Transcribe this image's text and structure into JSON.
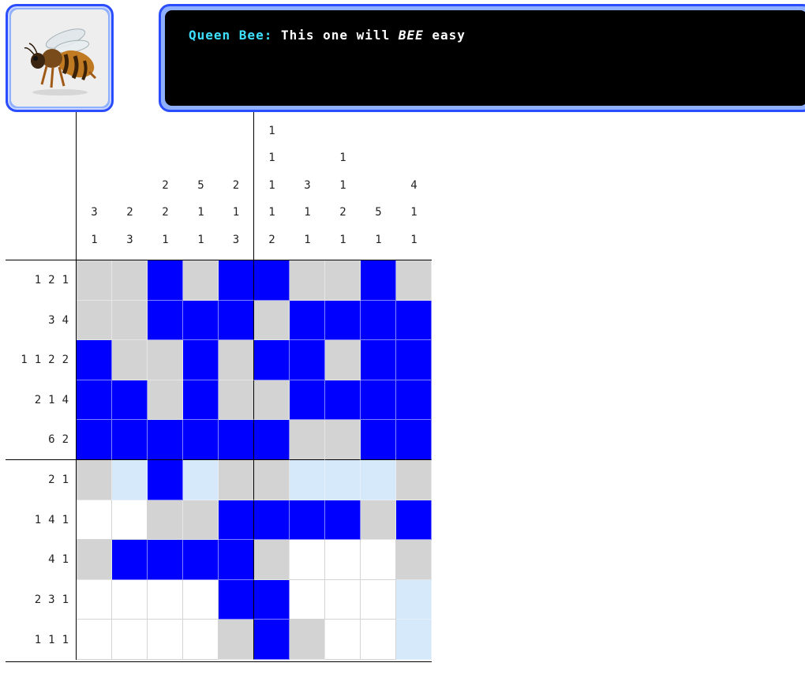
{
  "portrait": {
    "subject": "honeybee"
  },
  "dialog": {
    "speaker": "Queen Bee:",
    "text_before": "This one will ",
    "text_emph": "BEE",
    "text_after": " easy"
  },
  "colors": {
    "filled": "#0000ff",
    "crossed": "#d3d3d3",
    "hint": "#d6e9fb",
    "empty": "#ffffff",
    "frame": "#2a4dff"
  },
  "puzzle": {
    "col_clues": [
      [
        "3",
        "1"
      ],
      [
        "2",
        "3"
      ],
      [
        "2",
        "2",
        "1"
      ],
      [
        "5",
        "1",
        "1"
      ],
      [
        "2",
        "1",
        "3"
      ],
      [
        "1",
        "1",
        "1",
        "1",
        "2"
      ],
      [
        "3",
        "1",
        "1"
      ],
      [
        "1",
        "1",
        "2",
        "1"
      ],
      [
        "5",
        "1"
      ],
      [
        "4",
        "1",
        "1"
      ]
    ],
    "row_clues": [
      [
        "1",
        "2",
        "1"
      ],
      [
        "3",
        "4"
      ],
      [
        "1",
        "1",
        "2",
        "2"
      ],
      [
        "2",
        "1",
        "4"
      ],
      [
        "6",
        "2"
      ],
      [
        "2",
        "1"
      ],
      [
        "1",
        "4",
        "1"
      ],
      [
        "4",
        "1"
      ],
      [
        "2",
        "3",
        "1"
      ],
      [
        "1",
        "1",
        "1"
      ]
    ],
    "grid": [
      "xxfxffxxfx",
      "xxfffxffff",
      "fxxfxffxff",
      "ffxfxxffff",
      "ffffffxxff",
      "xhfhxxhhhx",
      "eexxffffxf",
      "xffffxeeex",
      "eeeeffeeeh",
      "eeeexfxeeh"
    ]
  }
}
